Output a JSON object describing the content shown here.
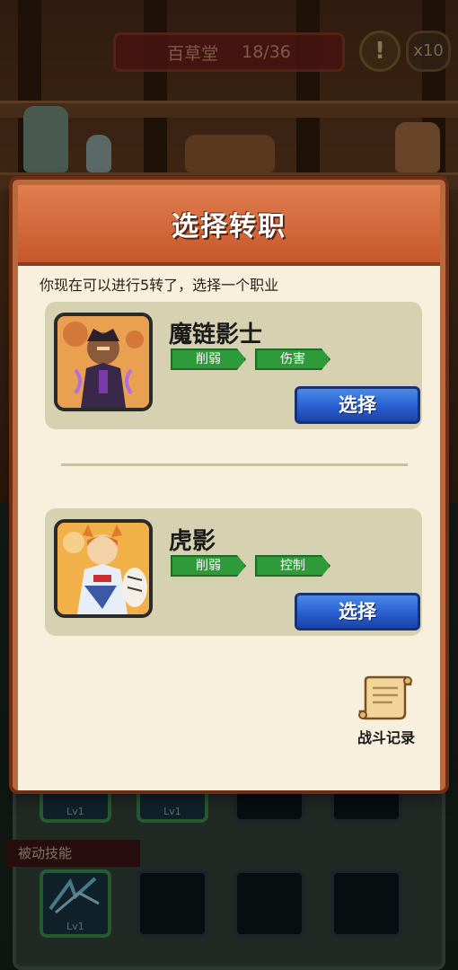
{
  "header": {
    "location_name": "百草堂",
    "progress": "18/36",
    "hint_icon": "!",
    "multiplier": "x10"
  },
  "background": {
    "passive_skills_label": "被动技能",
    "skill_slot_level": "Lv1"
  },
  "modal": {
    "title": "选择转职",
    "description": "你现在可以进行5转了，选择一个职业",
    "jobs": [
      {
        "name": "魔链影士",
        "tags": [
          "削弱",
          "伤害"
        ],
        "select_label": "选择"
      },
      {
        "name": "虎影",
        "tags": [
          "削弱",
          "控制"
        ],
        "select_label": "选择"
      }
    ],
    "battle_record_label": "战斗记录"
  },
  "colors": {
    "header_orange": "#d8683a",
    "panel_cream": "#f7f0dc",
    "card_bg": "#d6d1b0",
    "tag_green": "#2f9a3a",
    "button_blue": "#2a5ed0"
  }
}
